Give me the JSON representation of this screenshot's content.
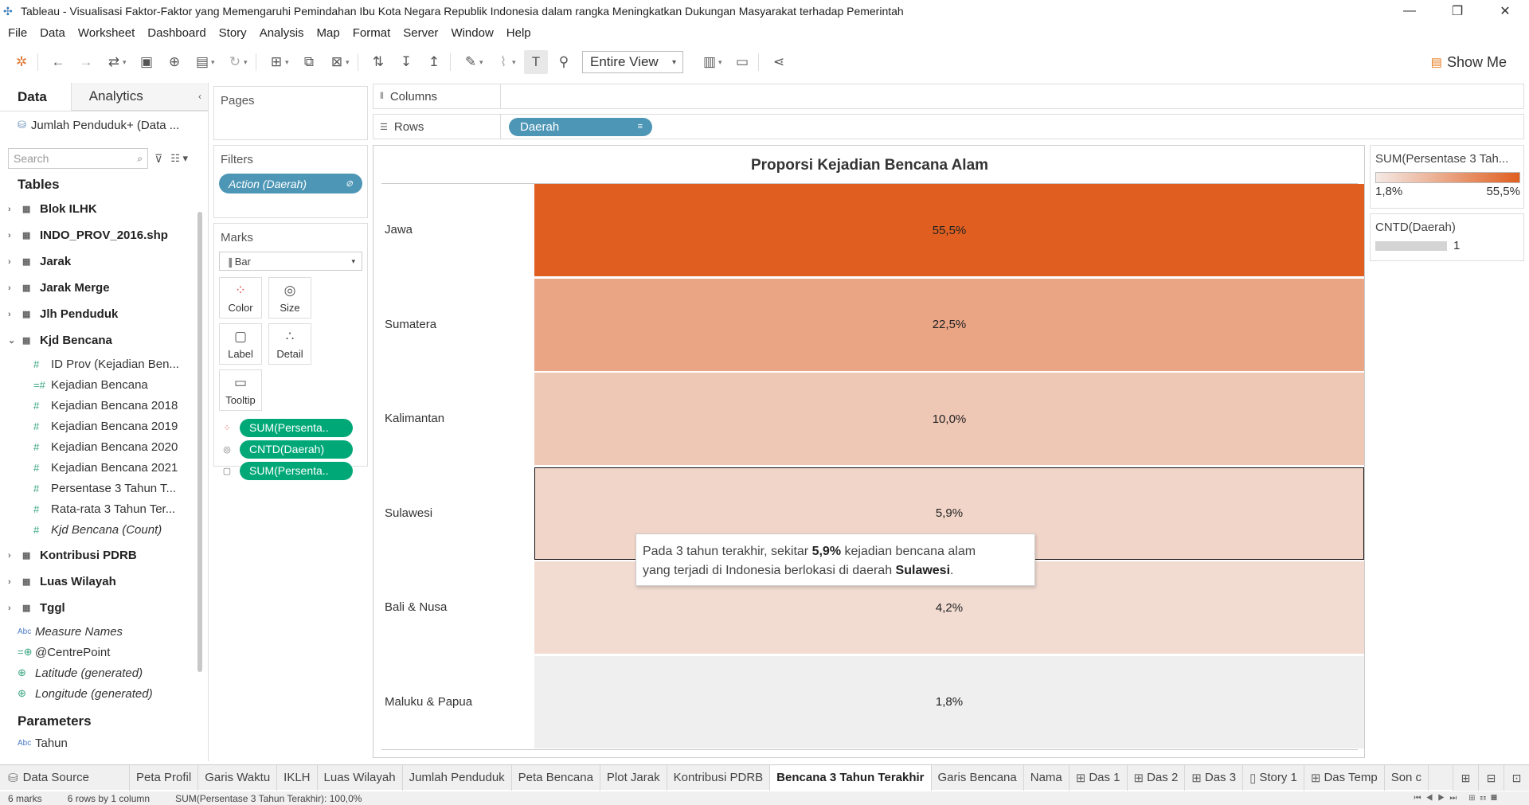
{
  "window": {
    "title": "Tableau - Visualisasi Faktor-Faktor yang Memengaruhi Pemindahan Ibu Kota Negara Republik Indonesia dalam rangka Meningkatkan Dukungan Masyarakat terhadap Pemerintah",
    "minimize": "—",
    "restore": "❐",
    "close": "✕"
  },
  "menu": [
    "File",
    "Data",
    "Worksheet",
    "Dashboard",
    "Story",
    "Analysis",
    "Map",
    "Format",
    "Server",
    "Window",
    "Help"
  ],
  "toolbar": {
    "fit_label": "Entire View",
    "show_me": "Show Me"
  },
  "data_pane": {
    "tab_data": "Data",
    "tab_analytics": "Analytics",
    "datasource": "Jumlah Penduduk+ (Data ...",
    "search_placeholder": "Search",
    "tables_header": "Tables",
    "tables": [
      "Blok ILHK",
      "INDO_PROV_2016.shp",
      "Jarak",
      "Jarak Merge",
      "Jlh Penduduk",
      "Kjd Bencana"
    ],
    "kjd_fields": [
      "ID Prov (Kejadian Ben...",
      "Kejadian Bencana",
      "Kejadian Bencana 2018",
      "Kejadian Bencana 2019",
      "Kejadian Bencana 2020",
      "Kejadian Bencana 2021",
      "Persentase 3 Tahun T...",
      "Rata-rata 3 Tahun Ter...",
      "Kjd Bencana (Count)"
    ],
    "tables_after": [
      "Kontribusi PDRB",
      "Luas Wilayah",
      "Tggl"
    ],
    "generated": [
      "Measure Names",
      "@CentrePoint",
      "Latitude (generated)",
      "Longitude (generated)"
    ],
    "parameters_header": "Parameters",
    "parameters": [
      "Tahun"
    ]
  },
  "cards": {
    "pages": "Pages",
    "filters": "Filters",
    "filter_pill": "Action (Daerah)",
    "marks": "Marks",
    "mark_type": "Bar",
    "mark_buttons": [
      "Color",
      "Size",
      "Label",
      "Detail",
      "Tooltip"
    ],
    "mark_pills": [
      "SUM(Persenta..",
      "CNTD(Daerah)",
      "SUM(Persenta.."
    ]
  },
  "shelves": {
    "columns": "Columns",
    "rows": "Rows",
    "rows_pill": "Daerah"
  },
  "chart_data": {
    "type": "bar",
    "title": "Proporsi Kejadian Bencana Alam",
    "categories": [
      "Jawa",
      "Sumatera",
      "Kalimantan",
      "Sulawesi",
      "Bali & Nusa",
      "Maluku & Papua"
    ],
    "values": [
      55.5,
      22.5,
      10.0,
      5.9,
      4.2,
      1.8
    ],
    "labels": [
      "55,5%",
      "22,5%",
      "10,0%",
      "5,9%",
      "4,2%",
      "1,8%"
    ],
    "color_scale": {
      "min": 1.8,
      "max": 55.5,
      "low": "#f4e9e5",
      "high": "#e05f20"
    },
    "highlighted": "Sulawesi"
  },
  "tooltip": {
    "line1_prefix": "Pada 3 tahun terakhir, sekitar ",
    "value": "5,9%",
    "line1_suffix": " kejadian bencana alam",
    "line2_prefix": "yang terjadi di Indonesia berlokasi di daerah ",
    "region": "Sulawesi",
    "line2_suffix": "."
  },
  "legends": {
    "color_title": "SUM(Persentase 3 Tah...",
    "color_min": "1,8%",
    "color_max": "55,5%",
    "size_title": "CNTD(Daerah)",
    "size_value": "1"
  },
  "sheet_tabs": {
    "data_source": "Data Source",
    "tabs": [
      "Peta Profil",
      "Garis Waktu",
      "IKLH",
      "Luas Wilayah",
      "Jumlah Penduduk",
      "Peta Bencana",
      "Plot Jarak",
      "Kontribusi PDRB",
      "Bencana 3 Tahun Terakhir",
      "Garis Bencana",
      "Nama",
      "Das 1",
      "Das 2",
      "Das 3",
      "Story 1",
      "Das Temp",
      "Son c"
    ],
    "active": "Bencana 3 Tahun Terakhir"
  },
  "status": {
    "marks": "6 marks",
    "rows": "6 rows by 1 column",
    "sum": "SUM(Persentase 3 Tahun Terakhir): 100,0%"
  }
}
